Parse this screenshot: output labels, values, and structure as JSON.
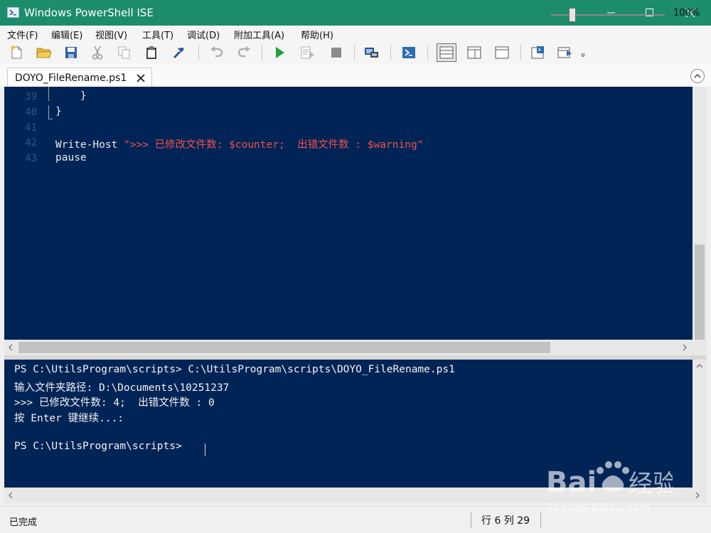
{
  "window": {
    "title": "Windows PowerShell ISE",
    "accent": "#1d8c6a"
  },
  "menu": [
    {
      "label": "文件(F)"
    },
    {
      "label": "编辑(E)"
    },
    {
      "label": "视图(V)"
    },
    {
      "label": "工具(T)"
    },
    {
      "label": "调试(D)"
    },
    {
      "label": "附加工具(A)"
    },
    {
      "label": "帮助(H)"
    }
  ],
  "tab": {
    "label": "DOYO_FileRename.ps1"
  },
  "editor": {
    "lines": [
      {
        "num": "39",
        "text": "    }"
      },
      {
        "num": "40",
        "text": "}"
      },
      {
        "num": "41",
        "text": ""
      },
      {
        "num": "42",
        "code": "Write-Host ",
        "string": "\">>> 已修改文件数: $counter;  出错文件数 : $warning\""
      },
      {
        "num": "43",
        "text": "pause"
      }
    ]
  },
  "console": {
    "lines": [
      "PS C:\\UtilsProgram\\scripts> C:\\UtilsProgram\\scripts\\DOYO_FileRename.ps1",
      "输入文件夹路径: D:\\Documents\\10251237",
      ">>> 已修改文件数: 4;  出错文件数 : 0",
      "按 Enter 键继续...:",
      "",
      "PS C:\\UtilsProgram\\scripts> "
    ]
  },
  "status": {
    "text": "已完成",
    "position": "行 6  列 29",
    "zoom": "100%",
    "zoom_level_percent": 100
  },
  "watermark": {
    "text": "jingyan.baidu.com"
  },
  "colors": {
    "editor_bg": "#012456",
    "string": "#f0504a",
    "line_number": "#33557a"
  }
}
